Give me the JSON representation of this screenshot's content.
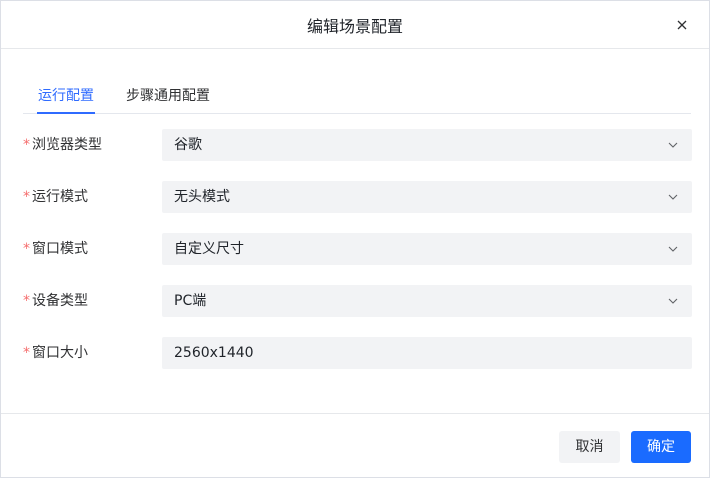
{
  "dialog": {
    "title": "编辑场景配置"
  },
  "tabs": [
    {
      "label": "运行配置",
      "active": true
    },
    {
      "label": "步骤通用配置",
      "active": false
    }
  ],
  "form": {
    "required_mark": "*",
    "fields": [
      {
        "label": "浏览器类型",
        "value": "谷歌",
        "type": "select"
      },
      {
        "label": "运行模式",
        "value": "无头模式",
        "type": "select"
      },
      {
        "label": "窗口模式",
        "value": "自定义尺寸",
        "type": "select"
      },
      {
        "label": "设备类型",
        "value": "PC端",
        "type": "select"
      },
      {
        "label": "窗口大小",
        "value": "2560x1440",
        "type": "input"
      }
    ]
  },
  "footer": {
    "cancel_label": "取消",
    "ok_label": "确定"
  },
  "colors": {
    "accent": "#2f6bff",
    "required": "#f56c6c",
    "field_bg": "#f2f3f5",
    "primary_button": "#1a6bff"
  },
  "icons": {
    "close": "close-icon",
    "select_arrow": "chevron-down-icon"
  }
}
